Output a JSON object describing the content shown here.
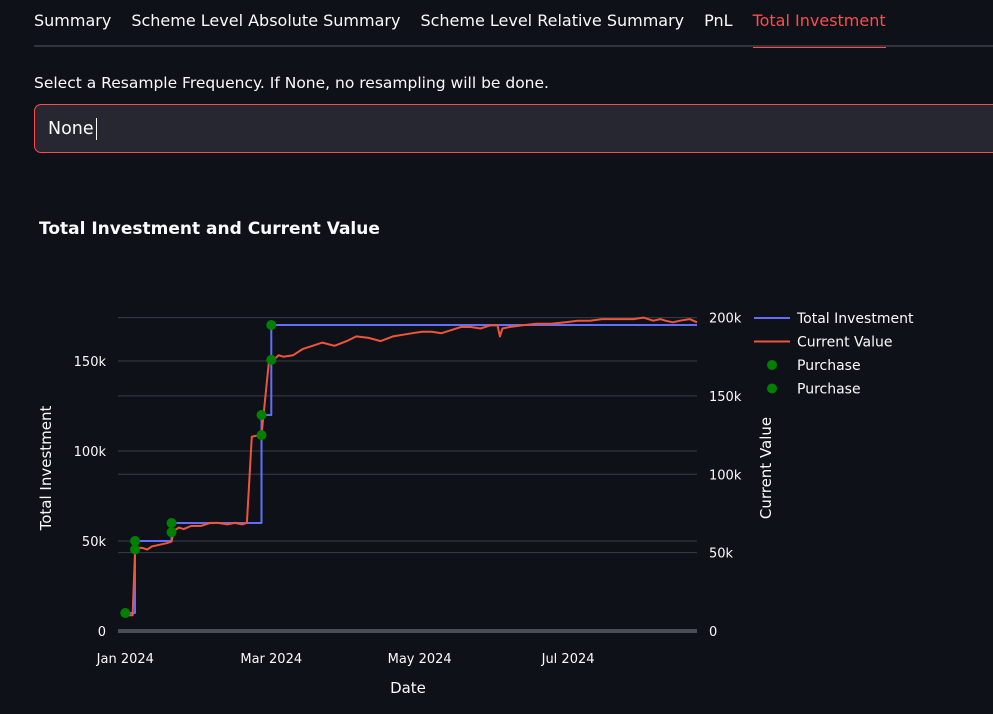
{
  "tabs": [
    {
      "label": "Summary",
      "active": false
    },
    {
      "label": "Scheme Level Absolute Summary",
      "active": false
    },
    {
      "label": "Scheme Level Relative Summary",
      "active": false
    },
    {
      "label": "PnL",
      "active": false
    },
    {
      "label": "Total Investment",
      "active": true
    }
  ],
  "resample": {
    "label": "Select a Resample Frequency. If None, no resampling will be done.",
    "value": "None"
  },
  "colors": {
    "accent": "#ff4b4b",
    "total_investment_line": "#636efa",
    "current_value_line": "#ef553b",
    "purchase_marker": "#008000"
  },
  "chart_data": {
    "type": "line",
    "title": "Total Investment and Current Value",
    "xlabel": "Date",
    "ylabel_left": "Total Investment",
    "ylabel_right": "Current Value",
    "xlim": [
      "2023-12-29",
      "2024-08-23"
    ],
    "ylim_left": [
      0,
      175000
    ],
    "ylim_right": [
      0,
      201000
    ],
    "x_ticks": [
      "Jan 2024",
      "Mar 2024",
      "May 2024",
      "Jul 2024"
    ],
    "y_left_ticks": [
      "0",
      "50k",
      "100k",
      "150k"
    ],
    "y_right_ticks": [
      "0",
      "50k",
      "100k",
      "150k",
      "200k"
    ],
    "grid": true,
    "legend_position": "right",
    "series": [
      {
        "name": "Total Investment",
        "axis": "left",
        "kind": "line",
        "x": [
          "2024-01-01",
          "2024-01-05",
          "2024-01-05",
          "2024-01-20",
          "2024-01-20",
          "2024-02-26",
          "2024-02-26",
          "2024-03-01",
          "2024-03-01",
          "2024-08-23"
        ],
        "y": [
          10000,
          10000,
          50000,
          50000,
          60000,
          60000,
          120000,
          120000,
          170000,
          170000
        ]
      },
      {
        "name": "Current Value",
        "axis": "right",
        "kind": "line",
        "x": [
          "2024-01-01",
          "2024-01-04",
          "2024-01-05",
          "2024-01-06",
          "2024-01-08",
          "2024-01-10",
          "2024-01-12",
          "2024-01-15",
          "2024-01-18",
          "2024-01-20",
          "2024-01-21",
          "2024-01-23",
          "2024-01-25",
          "2024-01-28",
          "2024-02-01",
          "2024-02-05",
          "2024-02-08",
          "2024-02-12",
          "2024-02-15",
          "2024-02-18",
          "2024-02-20",
          "2024-02-22",
          "2024-02-25",
          "2024-02-26",
          "2024-02-29",
          "2024-03-01",
          "2024-03-02",
          "2024-03-04",
          "2024-03-06",
          "2024-03-10",
          "2024-03-14",
          "2024-03-18",
          "2024-03-22",
          "2024-03-27",
          "2024-04-01",
          "2024-04-05",
          "2024-04-10",
          "2024-04-15",
          "2024-04-20",
          "2024-04-24",
          "2024-04-28",
          "2024-05-02",
          "2024-05-06",
          "2024-05-10",
          "2024-05-14",
          "2024-05-18",
          "2024-05-22",
          "2024-05-26",
          "2024-05-30",
          "2024-06-02",
          "2024-06-03",
          "2024-06-04",
          "2024-06-07",
          "2024-06-12",
          "2024-06-18",
          "2024-06-24",
          "2024-06-30",
          "2024-07-05",
          "2024-07-10",
          "2024-07-15",
          "2024-07-20",
          "2024-07-25",
          "2024-07-28",
          "2024-08-01",
          "2024-08-05",
          "2024-08-08",
          "2024-08-10",
          "2024-08-13",
          "2024-08-16",
          "2024-08-20",
          "2024-08-23"
        ],
        "y": [
          10000,
          10000,
          50000,
          53000,
          53000,
          52000,
          54000,
          55000,
          56000,
          57000,
          64000,
          66000,
          65000,
          67000,
          67000,
          69000,
          69000,
          68000,
          69000,
          68000,
          69000,
          124000,
          125000,
          125000,
          171000,
          174000,
          173000,
          176000,
          175000,
          176000,
          180000,
          182000,
          184000,
          182000,
          185000,
          188000,
          187000,
          185000,
          188000,
          189000,
          190000,
          191000,
          191000,
          190000,
          192000,
          194000,
          194000,
          193000,
          195000,
          195000,
          188000,
          193000,
          194000,
          195000,
          196000,
          196000,
          197000,
          198000,
          198000,
          199000,
          199000,
          199000,
          199000,
          200000,
          198000,
          199000,
          198000,
          197000,
          198000,
          199000,
          197000
        ]
      },
      {
        "name": "Purchase",
        "axis": "left",
        "kind": "markers",
        "x": [
          "2024-01-01",
          "2024-01-05",
          "2024-01-20",
          "2024-02-26",
          "2024-03-01"
        ],
        "y": [
          10000,
          50000,
          60000,
          120000,
          170000
        ]
      },
      {
        "name": "Purchase",
        "axis": "right",
        "kind": "markers",
        "x": [
          "2024-01-05",
          "2024-01-20",
          "2024-02-26",
          "2024-03-01"
        ],
        "y": [
          52000,
          63000,
          125000,
          173000
        ]
      }
    ]
  }
}
